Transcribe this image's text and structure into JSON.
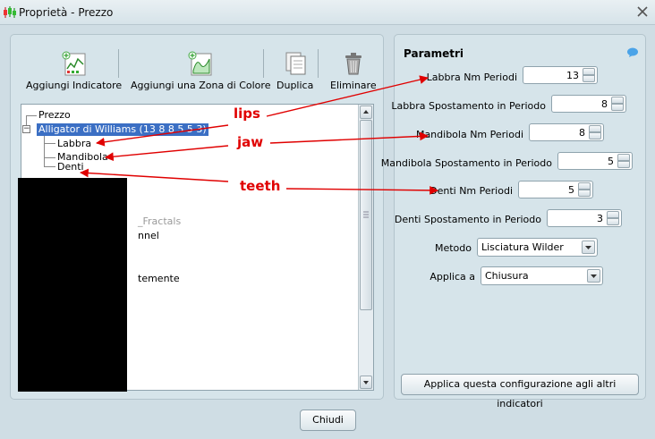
{
  "window": {
    "title": "Proprietà - Prezzo"
  },
  "toolbar": {
    "add_indicator": "Aggiungi Indicatore",
    "add_color_zone": "Aggiungi una Zona di Colore",
    "duplicate": "Duplica",
    "delete": "Eliminare"
  },
  "tree": {
    "root": "Prezzo",
    "selected": "Alligator di Williams (13 8 8 5 5 3)",
    "children": [
      "Labbra",
      "Mandibola",
      "Denti"
    ],
    "partial": [
      "_Fractals",
      "nnel",
      "temente"
    ]
  },
  "params": {
    "title": "Parametri",
    "rows": [
      {
        "label": "Labbra Nm Periodi",
        "value": "13"
      },
      {
        "label": "Labbra Spostamento in Periodo",
        "value": "8"
      },
      {
        "label": "Mandibola Nm Periodi",
        "value": "8"
      },
      {
        "label": "Mandibola Spostamento in Periodo",
        "value": "5"
      },
      {
        "label": "Denti Nm Periodi",
        "value": "5"
      },
      {
        "label": "Denti Spostamento in Periodo",
        "value": "3"
      }
    ],
    "method_label": "Metodo",
    "method_value": "Lisciatura Wilder",
    "apply_to_label": "Applica a",
    "apply_to_value": "Chiusura",
    "apply_all_button": "Applica questa configurazione agli altri indicatori"
  },
  "footer": {
    "close_button": "Chiudi"
  },
  "annotations": {
    "lips": "lips",
    "jaw": "jaw",
    "teeth": "teeth"
  },
  "colors": {
    "selection": "#3b6fc4",
    "annotation": "#e00000",
    "window_bg": "#cfdde4"
  }
}
